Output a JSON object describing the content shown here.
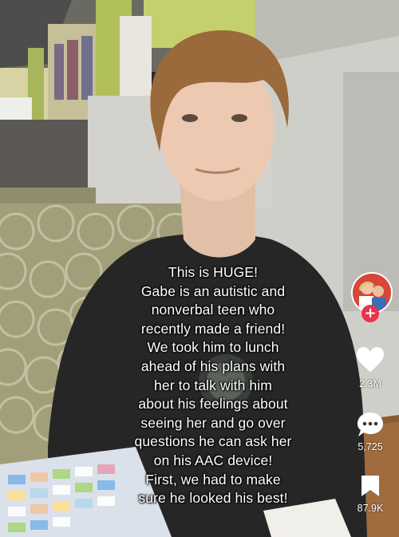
{
  "caption": {
    "lines": [
      "This is HUGE!",
      "Gabe is an autistic and",
      "nonverbal teen who",
      "recently made a friend!",
      "We took him to lunch",
      "ahead of his plans with",
      "her to talk with him",
      "about his feelings about",
      "seeing her and go over",
      "questions he can ask her",
      "on his AAC device!",
      "First, we had to make",
      "sure he looked his best!"
    ]
  },
  "actions": {
    "likes": "2.3M",
    "comments": "5,725",
    "saves": "87.9K"
  },
  "icons": {
    "follow": "plus-icon",
    "like": "heart-icon",
    "comment": "comment-bubble-icon",
    "save": "bookmark-icon"
  },
  "colors": {
    "follow_badge": "#e8344c",
    "caption_text": "#ffffff"
  }
}
